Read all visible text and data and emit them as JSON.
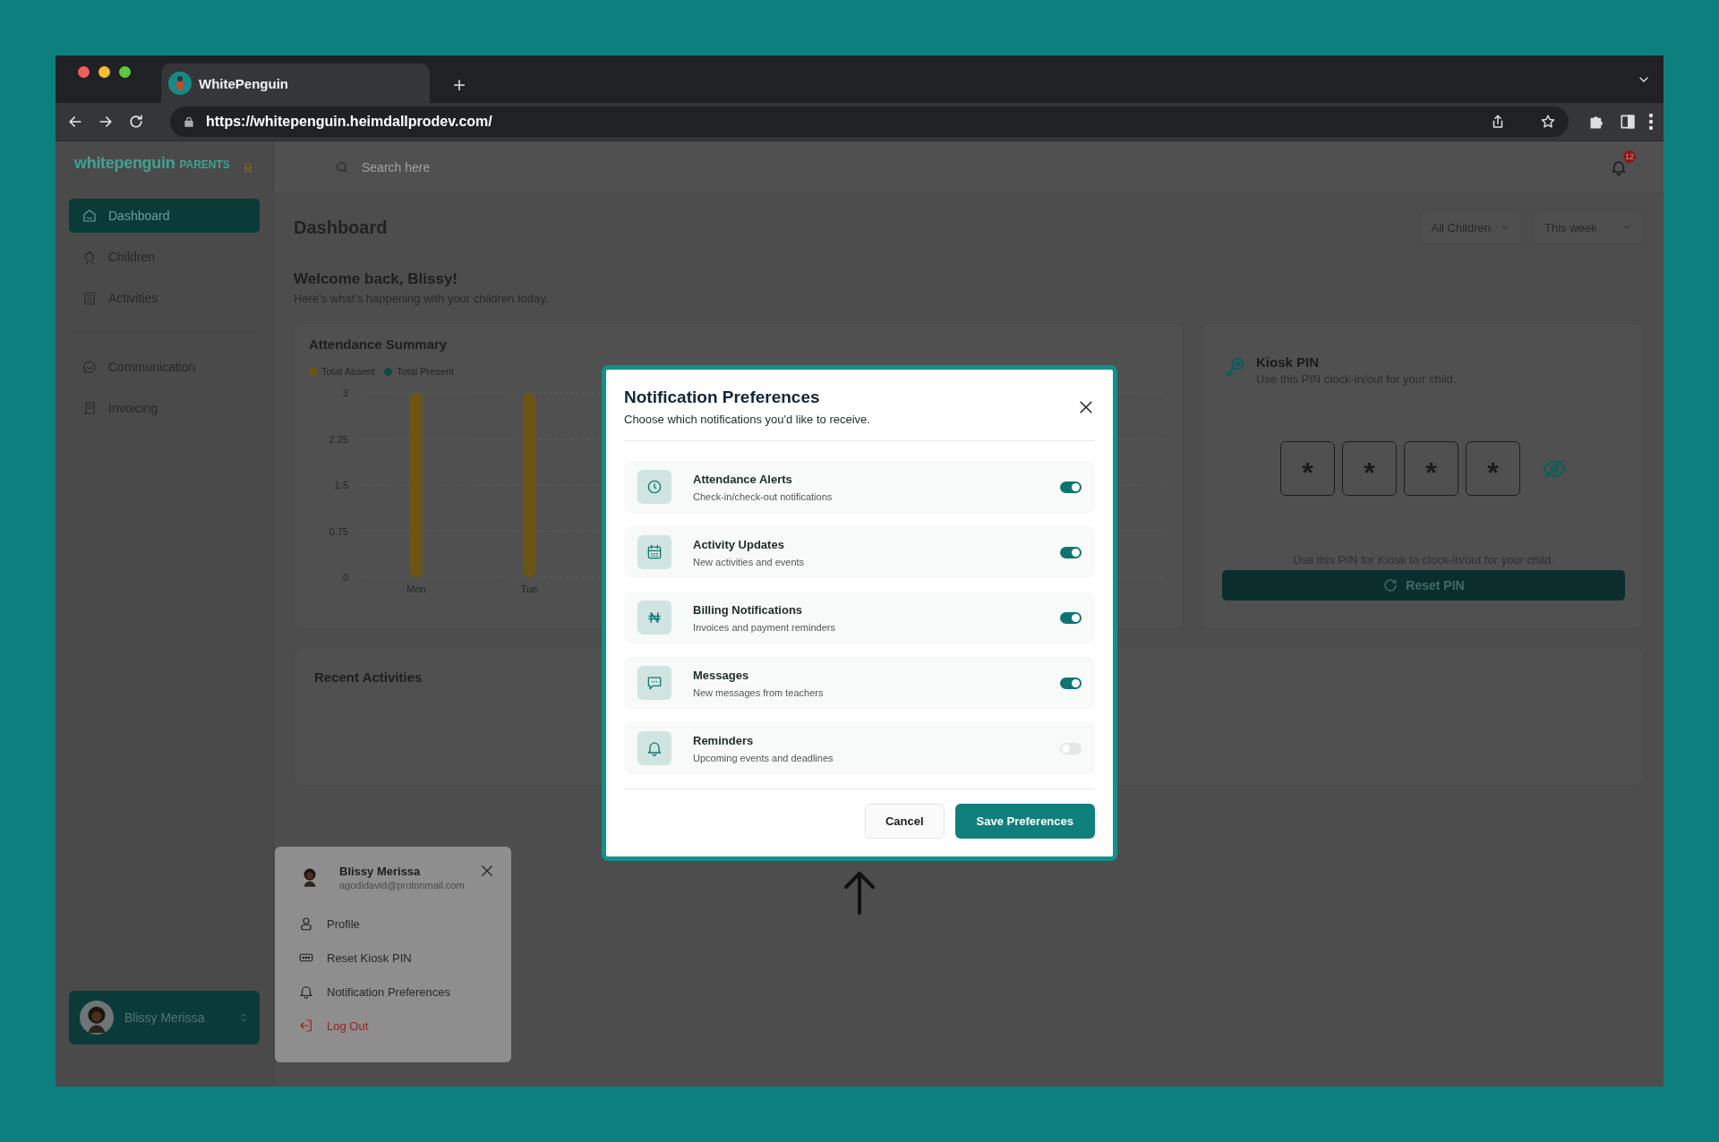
{
  "browser": {
    "tab_title": "WhitePenguin",
    "new_tab": "+",
    "url": "https://whitepenguin.heimdallprodev.com/"
  },
  "sidebar": {
    "logo": "whitepenguin",
    "logo_suffix": "PARENTS",
    "nav_groups": [
      [
        {
          "label": "Dashboard",
          "selected": true
        },
        {
          "label": "Children",
          "selected": false
        },
        {
          "label": "Activities",
          "selected": false
        }
      ],
      [
        {
          "label": "Communication",
          "selected": false
        },
        {
          "label": "Invoicing",
          "selected": false
        }
      ]
    ],
    "user_button": {
      "name": "Blissy Merissa"
    }
  },
  "header": {
    "search": {
      "placeholder": "Search here"
    },
    "notification_count": "12"
  },
  "page": {
    "title": "Dashboard",
    "filters": [
      "All Children",
      "This week"
    ],
    "welcome": "Welcome back, Blissy!",
    "subtitle": "Here's what's happening with your children today."
  },
  "attendance": {
    "title": "Attendance Summary",
    "chart_data": {
      "type": "bar",
      "categories": [
        "Mon",
        "Tue"
      ],
      "series": [
        {
          "name": "Total Absent",
          "color": "#6b5414",
          "values": [
            3,
            3
          ]
        },
        {
          "name": "Total Present",
          "color": "#0c4a3f",
          "values": [
            0,
            0
          ]
        }
      ],
      "stacked": true,
      "grid": true,
      "ylim": [
        0,
        3
      ],
      "yticks": [
        0,
        0.75,
        1.5,
        2.25,
        3
      ]
    }
  },
  "kiosk": {
    "title": "Kiosk PIN",
    "subtitle": "Use this PIN clock-in/out for your child.",
    "digits": [
      "*",
      "*",
      "*",
      "*"
    ],
    "note": "Use this PIN for Kiosk to clock-in/out for your child.",
    "button": "Reset PIN"
  },
  "recent": {
    "title": "Recent Activities"
  },
  "user_menu": {
    "name": "Blissy Merissa",
    "email": "agodidavid@protonmail.com",
    "items": [
      {
        "label": "Profile",
        "kind": "normal"
      },
      {
        "label": "Reset Kiosk PIN",
        "kind": "normal"
      },
      {
        "label": "Notification Preferences",
        "kind": "normal"
      },
      {
        "label": "Log Out",
        "kind": "danger"
      }
    ]
  },
  "modal": {
    "title": "Notification Preferences",
    "subtitle": "Choose which notifications you'd like to receive.",
    "options": [
      {
        "title": "Attendance Alerts",
        "description": "Check-in/check-out notifications",
        "on": true
      },
      {
        "title": "Activity Updates",
        "description": "New activities and events",
        "on": true
      },
      {
        "title": "Billing Notifications",
        "description": "Invoices and payment reminders",
        "on": true
      },
      {
        "title": "Messages",
        "description": "New messages from teachers",
        "on": true
      },
      {
        "title": "Reminders",
        "description": "Upcoming events and deadlines",
        "on": false
      }
    ],
    "cancel": "Cancel",
    "save": "Save Preferences"
  }
}
